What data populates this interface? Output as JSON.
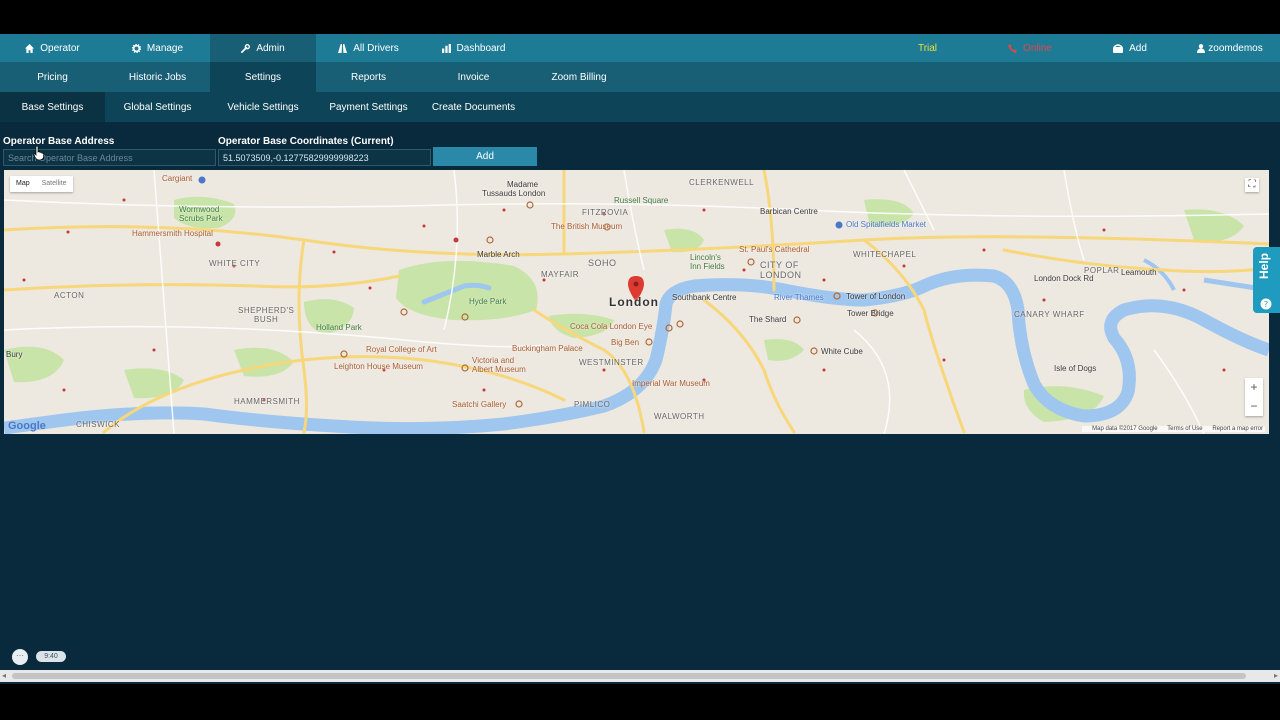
{
  "nav_top": {
    "items": [
      {
        "label": "Operator",
        "icon": "home-icon"
      },
      {
        "label": "Manage",
        "icon": "gear-icon"
      },
      {
        "label": "Admin",
        "icon": "wrench-icon"
      },
      {
        "label": "All Drivers",
        "icon": "road-icon"
      },
      {
        "label": "Dashboard",
        "icon": "chart-icon"
      }
    ],
    "trial": "Trial",
    "phone": "Online",
    "add": "Add",
    "user": "zoomdemos"
  },
  "nav_second": {
    "items": [
      "Pricing",
      "Historic Jobs",
      "Settings",
      "Reports",
      "Invoice",
      "Zoom Billing"
    ]
  },
  "nav_third": {
    "items": [
      "Base Settings",
      "Global Settings",
      "Vehicle Settings",
      "Payment Settings",
      "Create Documents"
    ]
  },
  "form": {
    "address_label": "Operator Base Address",
    "address_placeholder": "Search Operator Base Address",
    "coords_label": "Operator Base Coordinates (Current)",
    "coords_value": "51.5073509,-0.12775829999998223",
    "add_button": "Add"
  },
  "map": {
    "type_map": "Map",
    "type_satellite": "Satellite",
    "center_label": "London",
    "labels": {
      "cargiant": "Cargiant",
      "madame": "Madame",
      "tussauds": "Tussauds London",
      "clerkenwell": "CLERKENWELL",
      "wormwood": "Wormwood",
      "scrubs": "Scrubs Park",
      "hammersmith_hospital": "Hammersmith Hospital",
      "russell": "Russell Square",
      "fitzrovia": "FITZROVIA",
      "barbican": "Barbican Centre",
      "old_spitalfields": "Old Spitalfields Market",
      "british_museum": "The British Museum",
      "white_city": "WHITE CITY",
      "marble_arch": "Marble Arch",
      "soho": "SOHO",
      "lincoln1": "Lincoln's",
      "lincoln2": "Inn Fields",
      "st_pauls": "St. Paul's Cathedral",
      "city1": "CITY OF",
      "city2": "LONDON",
      "whitechapel": "WHITECHAPEL",
      "mayfair": "MAYFAIR",
      "poplar": "POPLAR",
      "leamouth": "Leamouth",
      "acton": "ACTON",
      "hyde_park": "Hyde Park",
      "southbank": "Southbank Centre",
      "tower_of_london": "Tower of London",
      "shepherds1": "SHEPHERD'S",
      "shepherds2": "BUSH",
      "tower_bridge": "Tower Bridge",
      "canary_wharf": "CANARY WHARF",
      "holland_park": "Holland Park",
      "coca_cola": "Coca Cola London Eye",
      "the_shard": "The Shard",
      "royal_college": "Royal College of Art",
      "buckingham": "Buckingham Palace",
      "big_ben": "Big Ben",
      "white_cube": "White Cube",
      "leighton": "Leighton House Museum",
      "victoria1": "Victoria and",
      "victoria2": "Albert Museum",
      "westminster": "WESTMINSTER",
      "isle_of_dogs": "Isle of Dogs",
      "imperial": "Imperial War Museum",
      "hammersmith": "HAMMERSMITH",
      "saatchi": "Saatchi Gallery",
      "pimlico": "PIMLICO",
      "chiswick": "CHISWICK",
      "walworth": "WALWORTH",
      "bury": "Bury",
      "limehouse": "London Dock Rd",
      "thames": "River Thames"
    },
    "google": "Google",
    "attribution": "Map data ©2017 Google",
    "terms": "Terms of Use",
    "report": "Report a map error"
  },
  "help_tab": "Help",
  "timer": "9:40",
  "colors": {
    "page_bg": "#082a3c",
    "nav_primary": "#1e7b96",
    "nav_secondary": "#185e75",
    "nav_tertiary": "#0e4457",
    "accent_button": "#2a89a8",
    "trial": "#e8e040",
    "phone": "#e04848",
    "map_water": "#9fc6ee",
    "map_park": "#c5e3a6",
    "map_marker": "#dd3a31"
  }
}
